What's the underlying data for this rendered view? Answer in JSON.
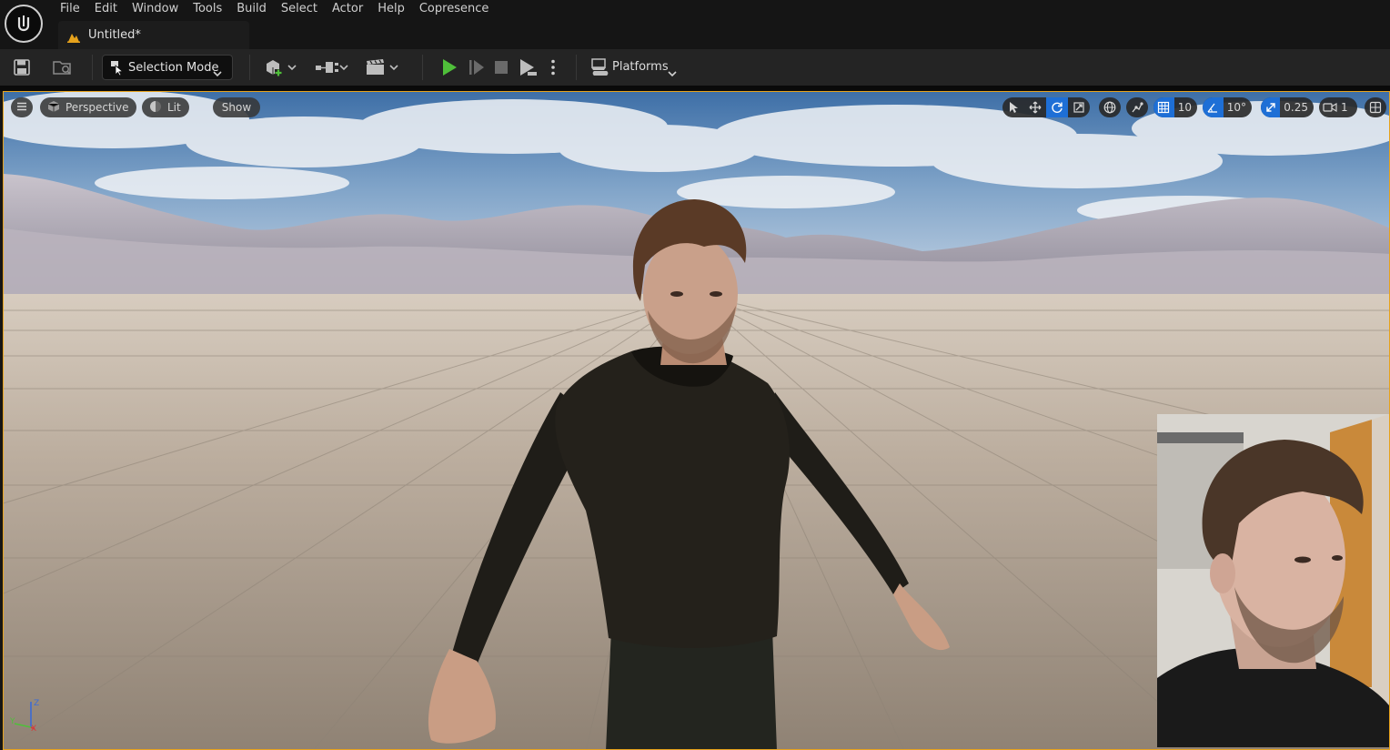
{
  "menu": {
    "items": [
      "File",
      "Edit",
      "Window",
      "Tools",
      "Build",
      "Select",
      "Actor",
      "Help",
      "Copresence"
    ]
  },
  "tab": {
    "title": "Untitled*"
  },
  "toolbar": {
    "selection_mode_label": "Selection Mode",
    "platforms_label": "Platforms",
    "icons": [
      "save-icon",
      "content-browser-icon",
      "add-actor-icon",
      "blueprint-icon",
      "cinematics-icon",
      "play-icon",
      "advance-frame-icon",
      "stop-icon",
      "eject-icon",
      "more-options-icon",
      "platforms-icon"
    ]
  },
  "viewport": {
    "perspective_label": "Perspective",
    "lit_label": "Lit",
    "show_label": "Show",
    "grid_snap_value": "10",
    "rotation_snap_value": "10°",
    "scale_snap_value": "0.25",
    "camera_speed_value": "1",
    "axis": {
      "x": "X",
      "y": "Y",
      "z": "Z"
    }
  },
  "colors": {
    "accent_orange": "#e6a21c",
    "active_blue": "#1e6fd6",
    "play_green": "#4fbf3a"
  }
}
